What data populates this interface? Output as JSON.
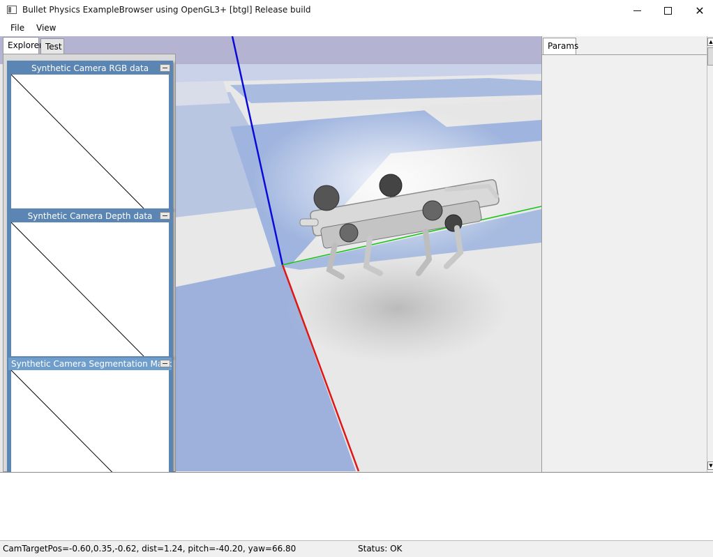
{
  "window": {
    "title": "Bullet Physics ExampleBrowser using OpenGL3+ [btgl] Release build",
    "close_glyph": "✕"
  },
  "menu": {
    "items": [
      "File",
      "View"
    ]
  },
  "left_tabs": [
    "Explorer",
    "Test"
  ],
  "right_tabs": [
    "Params"
  ],
  "camera_windows": [
    {
      "title": "Synthetic Camera RGB data"
    },
    {
      "title": "Synthetic Camera Depth data"
    },
    {
      "title": "Synthetic Camera Segmentation Mask"
    }
  ],
  "statusbar": {
    "camera_info": "CamTargetPos=-0.60,0.35,-0.62, dist=1.24, pitch=-40.20, yaw=66.80",
    "status": "Status: OK"
  },
  "scene": {
    "axis_colors": {
      "x": "#e01515",
      "y": "#19c419",
      "z": "#0a0ad8"
    },
    "floor_colors": {
      "light": "#e8e8e8",
      "blue": "#9fb4de",
      "sky": "#b4b4d2"
    }
  }
}
